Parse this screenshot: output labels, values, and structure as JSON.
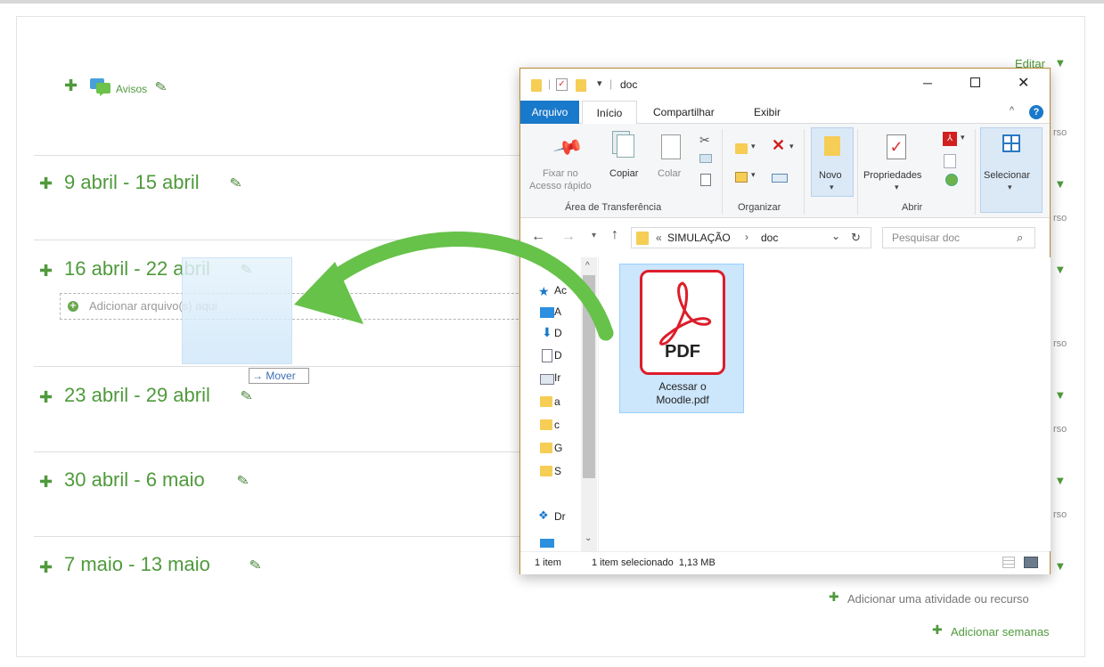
{
  "course": {
    "editar": "Editar",
    "avisos": "Avisos",
    "weeks": [
      "9 abril - 15 abril",
      "16 abril - 22 abril",
      "23 abril - 29 abril",
      "30 abril - 6 maio",
      "7 maio - 13 maio"
    ],
    "dropzone": "Adicionar arquivo(s) aqui",
    "move_hint": "Mover",
    "rso_text": "rso",
    "add_activity": "Adicionar uma atividade ou recurso",
    "add_weeks": "Adicionar semanas"
  },
  "explorer": {
    "title": "doc",
    "menu_tabs": {
      "arquivo": "Arquivo",
      "inicio": "Início",
      "compartilhar": "Compartilhar",
      "exibir": "Exibir"
    },
    "ribbon": {
      "fixar": "Fixar no",
      "acesso_rapido": "Acesso rápido",
      "copiar": "Copiar",
      "colar": "Colar",
      "novo": "Novo",
      "propriedades": "Propriedades",
      "selecionar": "Selecionar",
      "group_transfer": "Área de Transferência",
      "group_organizar": "Organizar",
      "group_abrir": "Abrir"
    },
    "address": {
      "prefix": "«",
      "part1": "SIMULAÇÃO",
      "separator": "›",
      "part2": "doc"
    },
    "search_placeholder": "Pesquisar doc",
    "nav_items": [
      "Ac",
      "A",
      "D",
      "D",
      "Ir",
      "a",
      "c",
      "G",
      "S",
      "Dr"
    ],
    "file": {
      "icon_text": "PDF",
      "name": "Acessar o Moodle.pdf"
    },
    "status": {
      "count": "1 item",
      "selected": "1 item selecionado  1,13 MB"
    }
  },
  "colors": {
    "moodle_green": "#4f9a3c",
    "arrow_green": "#67c24a",
    "pdf_red": "#dc1e2b",
    "ribbon_blue": "#1979ca",
    "selection_blue": "#cce6fb"
  }
}
